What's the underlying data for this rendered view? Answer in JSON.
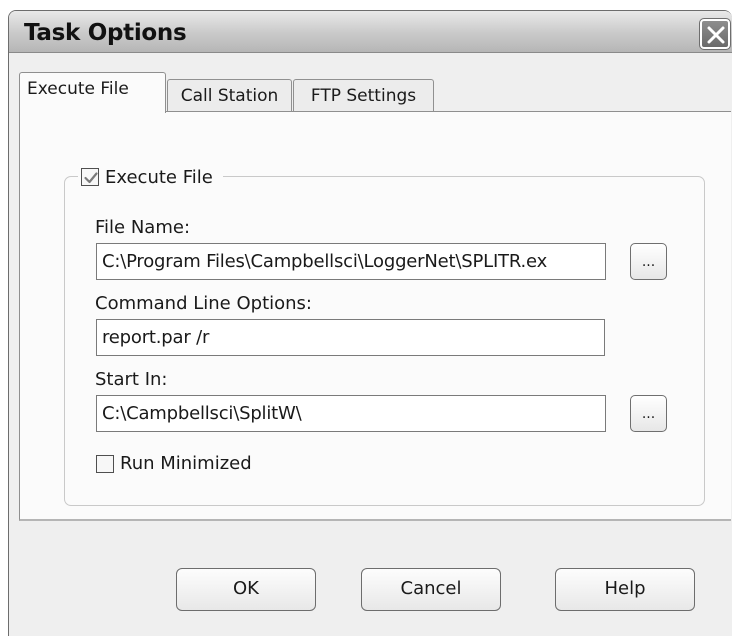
{
  "window": {
    "title": "Task Options",
    "close_icon": "close-icon"
  },
  "tabs": [
    {
      "label": "Execute File",
      "selected": true
    },
    {
      "label": "Call Station",
      "selected": false
    },
    {
      "label": "FTP Settings",
      "selected": false
    }
  ],
  "execute_group": {
    "checkbox_label": "Execute File",
    "checked": true,
    "file_name": {
      "label": "File Name:",
      "value": "C:\\Program Files\\Campbellsci\\LoggerNet\\SPLITR.ex",
      "browse_label": "..."
    },
    "command_line": {
      "label": "Command Line Options:",
      "value": "report.par /r"
    },
    "start_in": {
      "label": "Start In:",
      "value": "C:\\Campbellsci\\SplitW\\",
      "browse_label": "..."
    },
    "run_minimized": {
      "label": "Run Minimized",
      "checked": false
    }
  },
  "buttons": {
    "ok": "OK",
    "cancel": "Cancel",
    "help": "Help"
  }
}
